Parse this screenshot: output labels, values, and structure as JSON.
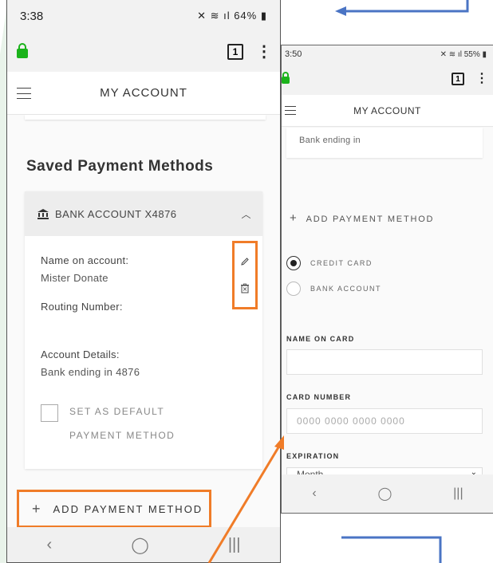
{
  "colors": {
    "highlight": "#f07c28",
    "arrow_blue": "#4a74c4",
    "secure_green": "#1bb31b"
  },
  "left": {
    "status": {
      "time": "3:38",
      "indicators": "64%"
    },
    "browser": {
      "tab_count": "1"
    },
    "header": {
      "title": "MY ACCOUNT"
    },
    "section_title": "Saved Payment Methods",
    "account": {
      "header_label": "BANK ACCOUNT X4876",
      "name_label": "Name on account:",
      "name_value": "Mister Donate",
      "routing_label": "Routing Number:",
      "details_label": "Account Details:",
      "details_value": "Bank ending in 4876",
      "default_label": "SET AS DEFAULT PAYMENT METHOD"
    },
    "add_button": "ADD PAYMENT METHOD"
  },
  "right": {
    "status": {
      "time": "3:50",
      "indicators": "55%"
    },
    "browser": {
      "tab_count": "1"
    },
    "header": {
      "title": "MY ACCOUNT"
    },
    "card_text": "Bank ending in",
    "add_label": "ADD PAYMENT METHOD",
    "radio_credit": "CREDIT CARD",
    "radio_bank": "BANK ACCOUNT",
    "name_on_card_label": "NAME ON CARD",
    "card_number_label": "CARD NUMBER",
    "card_number_placeholder": "0000 0000 0000 0000",
    "expiration_label": "EXPIRATION",
    "month_value": "Month"
  }
}
